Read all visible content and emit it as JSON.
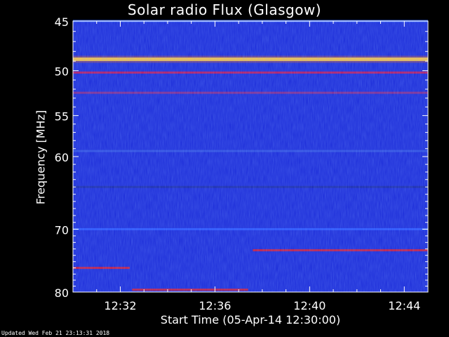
{
  "chart_data": {
    "type": "heatmap",
    "title": "Solar radio Flux (Glasgow)",
    "xlabel": "Start Time (05-Apr-14 12:30:00)",
    "ylabel": "Frequency [MHz]",
    "x_ticks": [
      "12:32",
      "12:36",
      "12:40",
      "12:44"
    ],
    "x_tick_minutes": [
      2,
      6,
      10,
      14
    ],
    "xlim_minutes": [
      0,
      15
    ],
    "y_ticks": [
      45,
      50,
      55,
      60,
      70,
      80
    ],
    "ylim": [
      45,
      80
    ],
    "y_scale": "log",
    "y_direction": "increasing-downward",
    "colormap": "blue-red-yellow",
    "background_color": "#1a2ad8",
    "features": [
      {
        "kind": "band",
        "freq_mhz": 45.0,
        "t_start": 0,
        "t_end": 15,
        "color": "#3a6bff"
      },
      {
        "kind": "band",
        "freq_mhz": 48.8,
        "t_start": 0,
        "t_end": 15,
        "color": "#ffff66"
      },
      {
        "kind": "band",
        "freq_mhz": 50.2,
        "t_start": 0,
        "t_end": 15,
        "color": "#c0185a"
      },
      {
        "kind": "band",
        "freq_mhz": 52.4,
        "t_start": 0,
        "t_end": 15,
        "color": "#8a2a8a"
      },
      {
        "kind": "band",
        "freq_mhz": 59.3,
        "t_start": 0,
        "t_end": 15,
        "color": "#3050e0"
      },
      {
        "kind": "band",
        "freq_mhz": 64.0,
        "t_start": 0,
        "t_end": 15,
        "color": "#1828a8"
      },
      {
        "kind": "band",
        "freq_mhz": 70.0,
        "t_start": 0,
        "t_end": 15,
        "color": "#2a55ff"
      },
      {
        "kind": "band",
        "freq_mhz": 73.2,
        "t_start": 7.6,
        "t_end": 15,
        "color": "#d01a3a"
      },
      {
        "kind": "band",
        "freq_mhz": 76.0,
        "t_start": 0,
        "t_end": 2.4,
        "color": "#d01a3a"
      },
      {
        "kind": "band",
        "freq_mhz": 79.6,
        "t_start": 2.5,
        "t_end": 7.4,
        "color": "#d01a3a"
      }
    ]
  },
  "footer": {
    "updated": "Updated Wed Feb 21 23:13:31 2018"
  }
}
